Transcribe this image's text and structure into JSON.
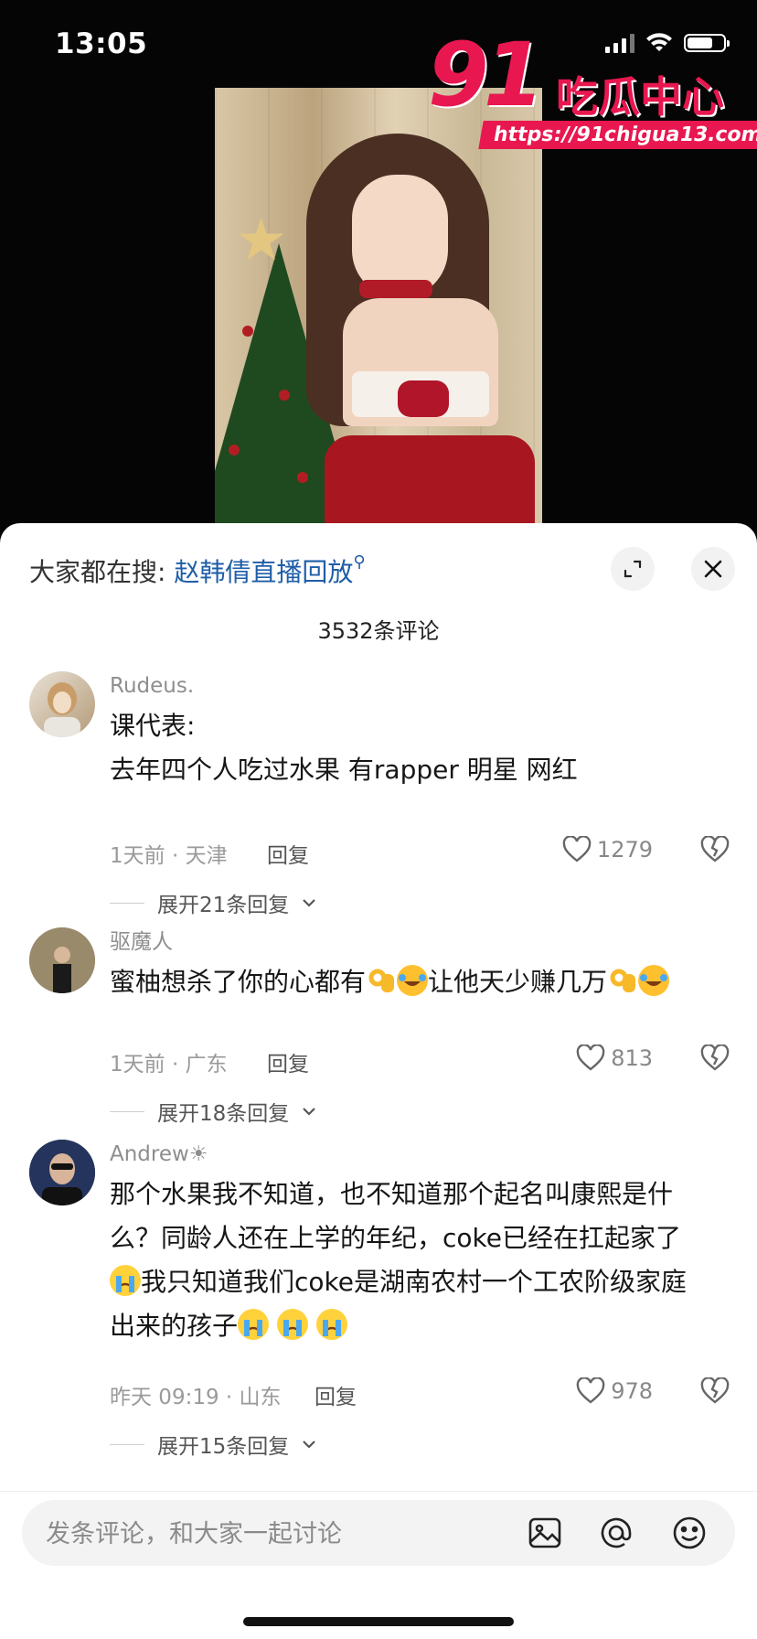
{
  "status_bar": {
    "time": "13:05"
  },
  "watermark": {
    "number": "91",
    "text": "吃瓜中心",
    "url": "https://91chigua13.com"
  },
  "sheet": {
    "hot_search_prefix": "大家都在搜: ",
    "hot_search_keyword": "赵韩倩直播回放",
    "comment_count": "3532条评论",
    "comments": [
      {
        "username": "Rudeus.",
        "lines": [
          "课代表:",
          "去年四个人吃过水果 有rapper 明星 网红"
        ],
        "meta": "1天前 · 天津",
        "reply_label": "回复",
        "likes": "1279",
        "expand_label": "展开21条回复"
      },
      {
        "username": "驱魔人",
        "text_a": "蜜柚想杀了你的心都有",
        "text_b": "让他天少赚几万",
        "meta": "1天前 · 广东",
        "reply_label": "回复",
        "likes": "813",
        "expand_label": "展开18条回复"
      },
      {
        "username": "Andrew☀",
        "line1": "那个水果我不知道，也不知道那个起名叫康熙是什",
        "line2": "么？同龄人还在上学的年纪，coke已经在扛起家了",
        "line3": "我只知道我们coke是湖南农村一个工农阶级家庭",
        "line4": "出来的孩子",
        "meta": "昨天 09:19 · 山东",
        "reply_label": "回复",
        "likes": "978",
        "expand_label": "展开15条回复"
      }
    ]
  },
  "input": {
    "placeholder": "发条评论，和大家一起讨论"
  },
  "icons": {
    "expand": "expand-icon",
    "close": "close-icon",
    "heart": "heart-icon",
    "dislike": "broken-heart-icon",
    "image": "image-icon",
    "mention": "at-icon",
    "emoji": "emoji-icon"
  }
}
